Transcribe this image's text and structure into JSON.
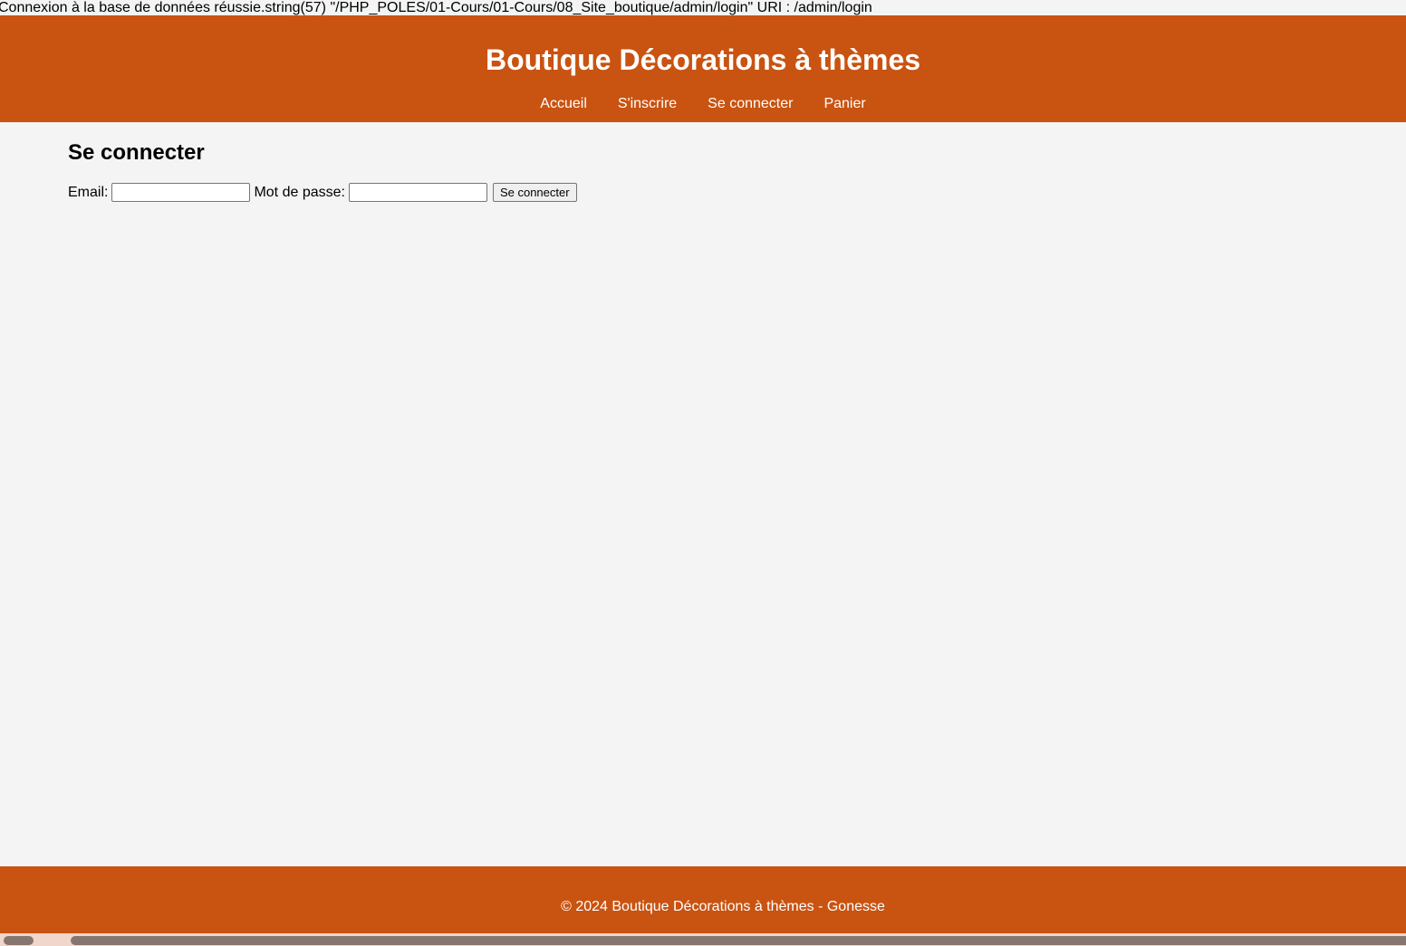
{
  "debug_output": "Connexion à la base de données réussie.string(57) \"/PHP_POLES/01-Cours/01-Cours/08_Site_boutique/admin/login\" URI : /admin/login",
  "header": {
    "title": "Boutique Décorations à thèmes",
    "nav": [
      {
        "label": "Accueil"
      },
      {
        "label": "S'inscrire"
      },
      {
        "label": "Se connecter"
      },
      {
        "label": "Panier"
      }
    ]
  },
  "main": {
    "title": "Se connecter",
    "form": {
      "email_label": "Email:",
      "email_value": "",
      "password_label": "Mot de passe:",
      "password_value": "",
      "submit_label": "Se connecter"
    }
  },
  "footer": {
    "text": "© 2024 Boutique Décorations à thèmes - Gonesse"
  },
  "colors": {
    "brand": "#c95311",
    "background": "#f4f4f4",
    "text_on_brand": "#ffffff"
  }
}
